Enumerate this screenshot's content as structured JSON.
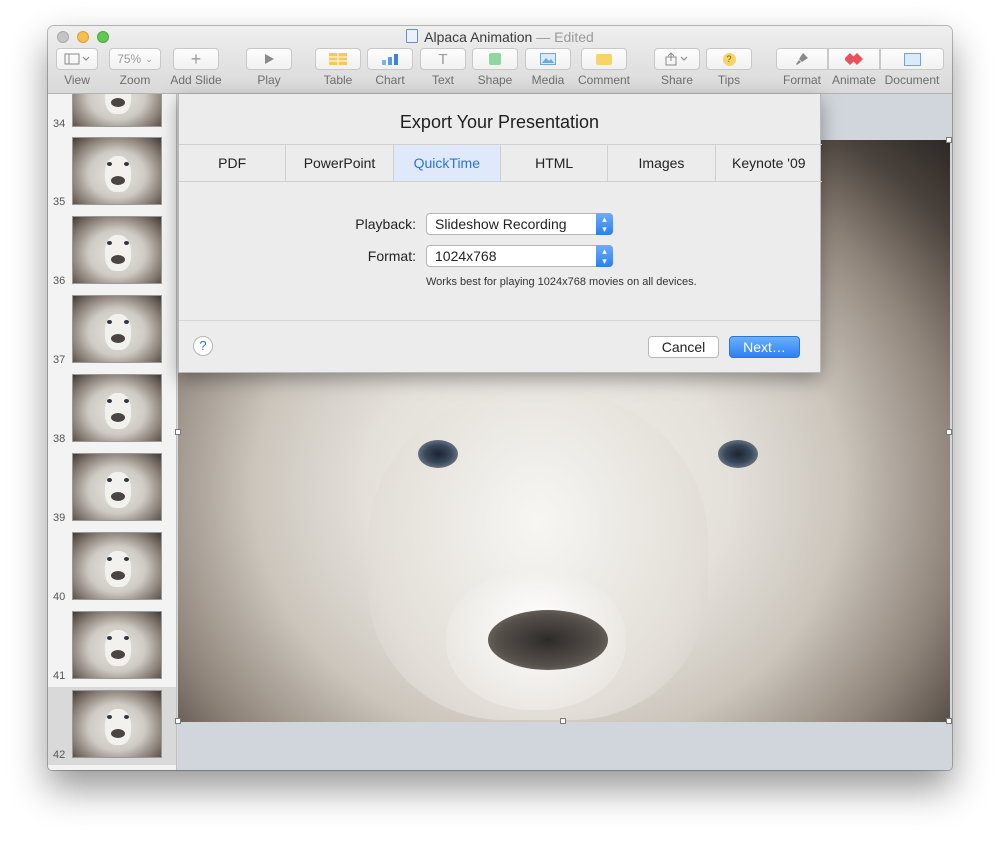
{
  "window": {
    "title": "Alpaca Animation",
    "title_suffix": "— Edited"
  },
  "toolbar": {
    "view": "View",
    "zoom_value": "75%",
    "zoom": "Zoom",
    "add_slide": "Add Slide",
    "play": "Play",
    "table": "Table",
    "chart": "Chart",
    "text": "Text",
    "shape": "Shape",
    "media": "Media",
    "comment": "Comment",
    "share": "Share",
    "tips": "Tips",
    "format": "Format",
    "animate": "Animate",
    "document": "Document"
  },
  "slides": [
    "34",
    "35",
    "36",
    "37",
    "38",
    "39",
    "40",
    "41",
    "42"
  ],
  "export": {
    "title": "Export Your Presentation",
    "tabs": [
      "PDF",
      "PowerPoint",
      "QuickTime",
      "HTML",
      "Images",
      "Keynote '09"
    ],
    "active_tab": "QuickTime",
    "playback_label": "Playback:",
    "playback_value": "Slideshow Recording",
    "format_label": "Format:",
    "format_value": "1024x768",
    "hint": "Works best for playing 1024x768 movies on all devices.",
    "help": "?",
    "cancel": "Cancel",
    "next": "Next…"
  },
  "colors": {
    "accent": "#2a7ef3",
    "active_tab_bg": "#dfe9fb"
  }
}
